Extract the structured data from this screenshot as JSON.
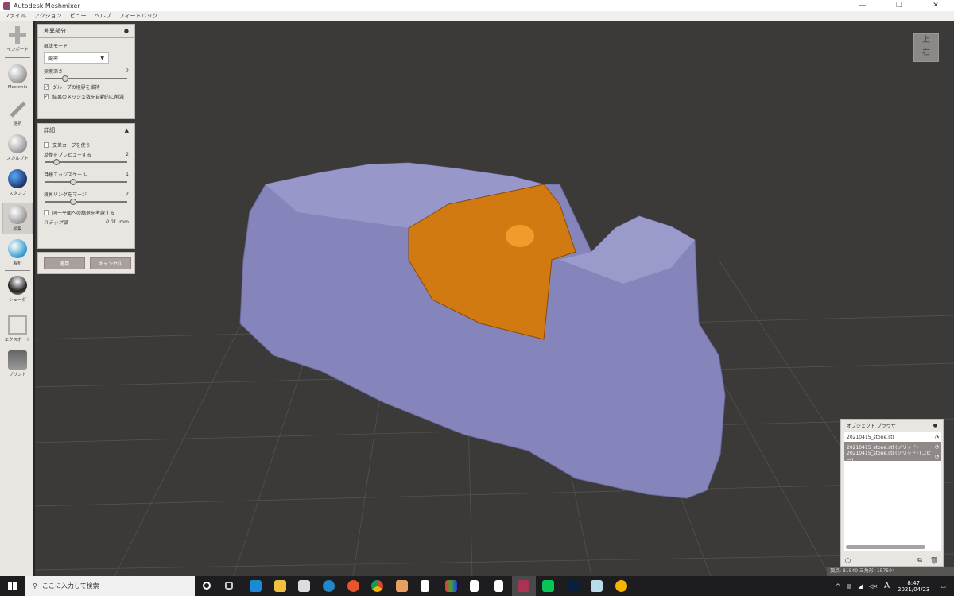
{
  "window": {
    "title": "Autodesk Meshmixer",
    "min": "—",
    "restore": "❐",
    "close": "✕"
  },
  "menu": [
    "ファイル",
    "アクション",
    "ビュー",
    "ヘルプ",
    "フィードバック"
  ],
  "toolbar": [
    "インポート",
    "Meshmix",
    "選択",
    "スカルプト",
    "スタンプ",
    "編集",
    "解析",
    "シェーダ",
    "エクスポート",
    "プリント"
  ],
  "panel": {
    "title": "差異部分",
    "mode_label": "解法モード",
    "mode_value": "厳密",
    "depth_label": "探索深さ",
    "depth_value": "2",
    "depth_fraction": 0.2,
    "keep_groups": "グループの境界を維持",
    "reduce": "結果のメッシュ数を自動的に削減"
  },
  "details": {
    "title": "詳細",
    "use_curves": "交差カーブを使う",
    "preview_label": "反復をプレビューする",
    "preview_value": "2",
    "preview_fraction": 0.1,
    "edge_label": "目標エッジスケール",
    "edge_value": "1",
    "edge_fraction": 0.3,
    "merge_label": "境界リングをマージ",
    "merge_value": "2",
    "merge_fraction": 0.3,
    "coplanar": "同一平面への縮退を考慮する",
    "step_label": "ステップ値",
    "step_value": "0.01",
    "step_unit": "mm"
  },
  "buttons": {
    "apply": "適用",
    "cancel": "キャンセル"
  },
  "viewcube": {
    "top": "上",
    "front": "右"
  },
  "object_browser": {
    "title": "オブジェクト ブラウザ",
    "items": [
      {
        "name": "20210415_stone.stl",
        "selected": false
      },
      {
        "name": "20210415_stone.stl (ソリッド)",
        "selected": true
      },
      {
        "name": "20210415_stone.stl (ソリッド) (コピー)",
        "selected": true
      }
    ]
  },
  "status": "頂点: 81540 三角形: 157504",
  "taskbar": {
    "search_placeholder": "ここに入力して検索",
    "time": "8:47",
    "date": "2021/04/23",
    "ime": "A"
  },
  "colors": {
    "mesh": "#8584bb",
    "cut": "#d27a12",
    "viewport": "#3b3a38"
  }
}
